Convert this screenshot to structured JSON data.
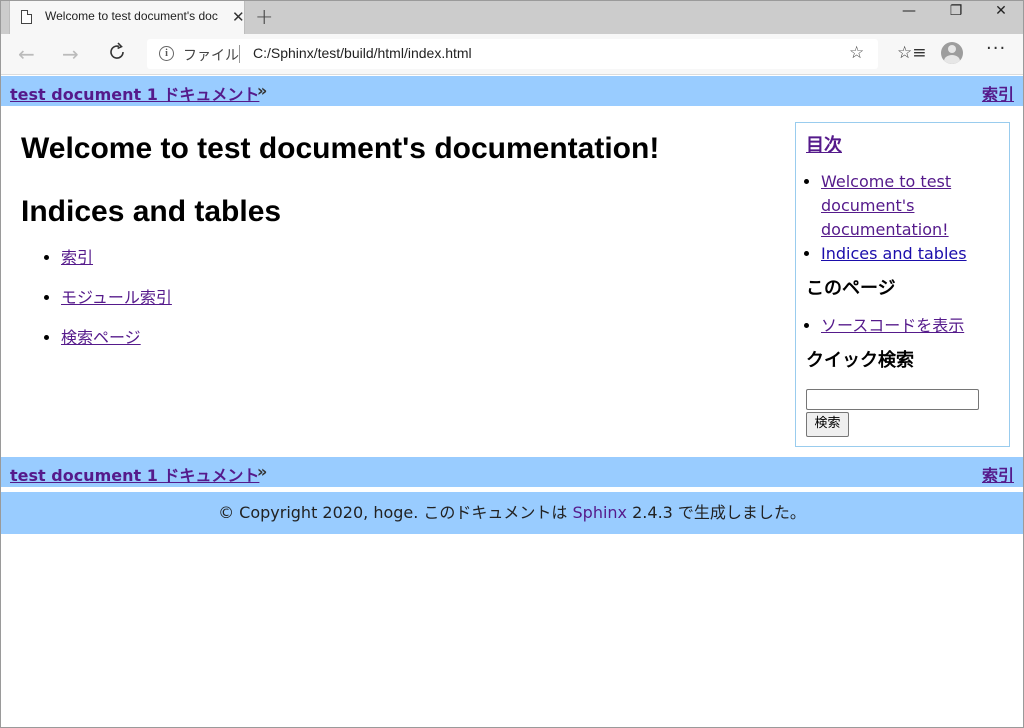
{
  "browser": {
    "tab_title": "Welcome to test document's doc",
    "new_tab": "+",
    "window_controls": {
      "minimize": "—",
      "restore": "❐",
      "close": "✕"
    },
    "address": {
      "scheme_label": "ファイル",
      "url": "C:/Sphinx/test/build/html/index.html"
    },
    "icons": {
      "back": "back-arrow-icon",
      "forward": "forward-arrow-icon",
      "reload": "reload-icon",
      "info": "info-icon",
      "favorite": "star-icon",
      "favorites_list": "favorites-list-icon",
      "profile": "profile-avatar-icon",
      "more": "more-dots-icon"
    }
  },
  "page": {
    "relbar": {
      "crumb": "test document 1 ドキュメント",
      "raquo": "»",
      "index": "索引"
    },
    "main": {
      "h1": "Welcome to test document's documentation!",
      "h2": "Indices and tables",
      "links": [
        "索引",
        "モジュール索引",
        "検索ページ"
      ]
    },
    "sidebar": {
      "toc_title": "目次",
      "toc_items": [
        "Welcome to test document's documentation!",
        "Indices and tables"
      ],
      "this_page_title": "このページ",
      "show_source": "ソースコードを表示",
      "quick_search_title": "クイック検索",
      "search_button": "検索"
    },
    "footer": {
      "prefix": "© Copyright 2020, hoge. このドキュメントは ",
      "sphinx_link": "Sphinx",
      "suffix": " 2.4.3 で生成しました。"
    },
    "colors": {
      "bar_bg": "#99ccff",
      "link_visited": "#551a8b",
      "link": "#1a0dab",
      "sidebar_border": "#99ccee"
    }
  }
}
